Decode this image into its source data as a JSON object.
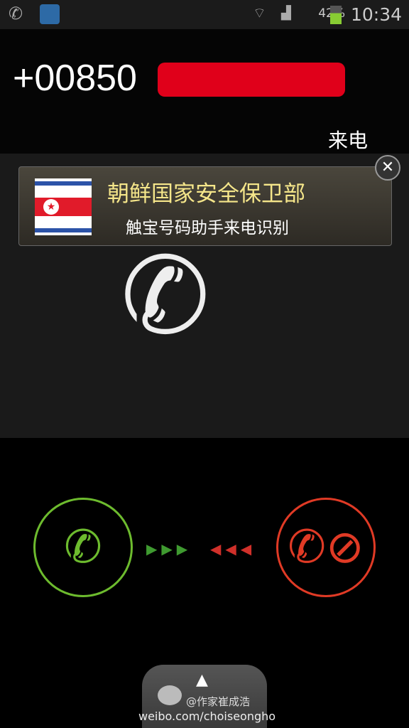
{
  "status_bar": {
    "time": "10:34",
    "battery": "42%",
    "icons": [
      "phone-icon",
      "call-app-icon",
      "wifi-icon",
      "signal-icon",
      "battery-charging-icon"
    ]
  },
  "call": {
    "number": "+00850",
    "label": "来电"
  },
  "caller_id": {
    "name": "朝鲜国家安全保卫部",
    "source": "触宝号码助手来电识别",
    "flag": "north-korea-flag"
  },
  "actions": {
    "accept_color": "#6dbb2e",
    "reject_color": "#e03a25",
    "arrows_left": "▶▶▶",
    "arrows_right": "◀◀◀"
  },
  "drawer": {
    "handle": "▲"
  },
  "watermark": {
    "handle": "@作家崔成浩",
    "url": "weibo.com/choiseongho"
  }
}
